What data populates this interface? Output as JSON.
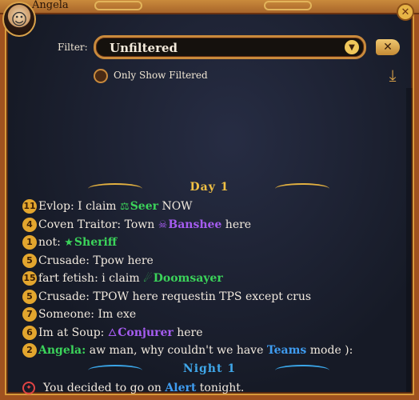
{
  "window": {
    "title": "Angela"
  },
  "filter": {
    "label": "Filter:",
    "value": "Unfiltered",
    "toggle_label": "Only Show Filtered"
  },
  "colors": {
    "day": "#f0c044",
    "night": "#3fa6e8",
    "seer": "#3bd35a",
    "sheriff": "#3bd35a",
    "doomsayer": "#3bd35a",
    "banshee": "#a55cf0",
    "conjurer": "#a55cf0",
    "teams": "#3f9cf0",
    "alert": "#3f9cf0",
    "angela": "#3bd35a"
  },
  "chat": {
    "day_header": "Day 1",
    "night_header": "Night 1",
    "messages": [
      {
        "num": "11",
        "name": "Evlop:",
        "text": "I claim",
        "role_icon": "scales-icon",
        "role": "Seer",
        "role_color": "#3bd35a",
        "after": "NOW"
      },
      {
        "num": "4",
        "name": "Coven Traitor:",
        "text": "Town",
        "role_icon": "banshee-icon",
        "role": "Banshee",
        "role_color": "#a55cf0",
        "after": "here"
      },
      {
        "num": "1",
        "name": "not:",
        "text": "",
        "role_icon": "star-icon",
        "role": "Sheriff",
        "role_color": "#3bd35a",
        "after": ""
      },
      {
        "num": "5",
        "name": "Crusade:",
        "text": "Tpow here",
        "role_icon": "",
        "role": "",
        "role_color": "",
        "after": ""
      },
      {
        "num": "15",
        "name": "fart fetish:",
        "text": "i claim",
        "role_icon": "doomsayer-icon",
        "role": "Doomsayer",
        "role_color": "#3bd35a",
        "after": ""
      },
      {
        "num": "5",
        "name": "Crusade:",
        "text": "TPOW here requestin TPS except crus",
        "role_icon": "",
        "role": "",
        "role_color": "",
        "after": ""
      },
      {
        "num": "7",
        "name": "Someone:",
        "text": "Im exe",
        "role_icon": "",
        "role": "",
        "role_color": "",
        "after": ""
      },
      {
        "num": "6",
        "name": "Im at Soup:",
        "text": "",
        "role_icon": "flame-icon",
        "role": "Conjurer",
        "role_color": "#a55cf0",
        "after": "here"
      },
      {
        "num": "2",
        "name": "Angela:",
        "text": "aw man, why couldn't we have",
        "role_icon": "",
        "role": "Teams",
        "role_color": "#3f9cf0",
        "after": "mode ):"
      }
    ],
    "notice": {
      "pre": "You decided to go on",
      "keyword": "Alert",
      "post": "tonight."
    }
  }
}
